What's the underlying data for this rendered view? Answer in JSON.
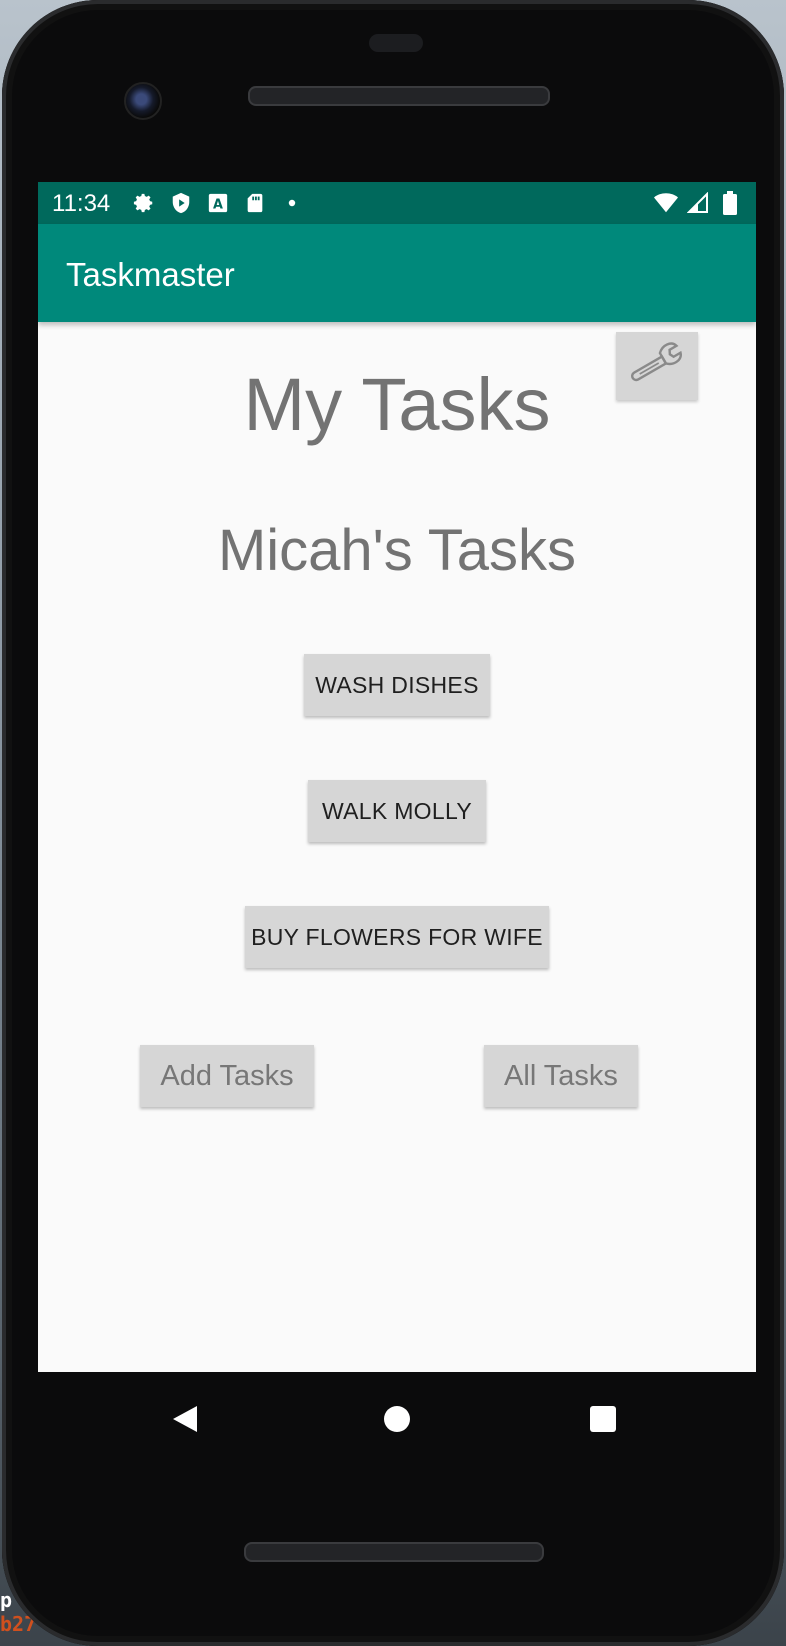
{
  "status_bar": {
    "time": "11:34",
    "left_icons": [
      "gear-icon",
      "shield-play-icon",
      "font-a-icon",
      "sd-card-icon",
      "dot-icon"
    ],
    "right_icons": [
      "wifi-icon",
      "signal-icon",
      "battery-icon"
    ]
  },
  "app_bar": {
    "title": "Taskmaster"
  },
  "main": {
    "title": "My Tasks",
    "user_heading": "Micah's Tasks",
    "tasks": [
      "WASH DISHES",
      "WALK MOLLY",
      "BUY FLOWERS FOR WIFE"
    ],
    "add_button": "Add Tasks",
    "all_button": "All Tasks",
    "settings_icon": "wrench-icon"
  },
  "nav_bar": {
    "icons": [
      "back-icon",
      "home-icon",
      "recents-icon"
    ]
  },
  "background_text": [
    "p",
    "b27"
  ],
  "colors": {
    "status_bar": "#00695c",
    "app_bar": "#00897b",
    "screen_bg": "#fafafa",
    "button_bg": "#d6d6d6",
    "heading_text": "#737373",
    "bg_accent_text": "#d0501e"
  }
}
